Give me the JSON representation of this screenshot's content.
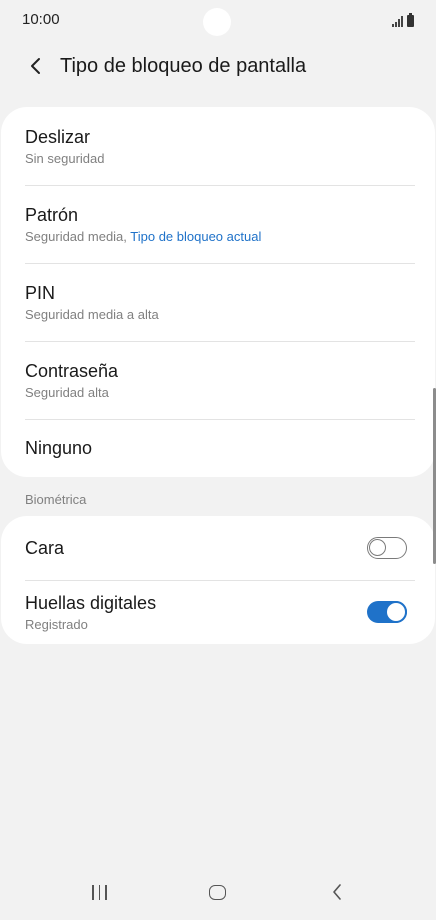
{
  "status_bar": {
    "time": "10:00",
    "icons": [
      "signal-icon",
      "battery-icon"
    ]
  },
  "header": {
    "back_icon": "chevron-left-icon",
    "title": "Tipo de bloqueo de pantalla"
  },
  "lock_types": [
    {
      "title": "Deslizar",
      "subtitle": "Sin seguridad"
    },
    {
      "title": "Patrón",
      "subtitle": "Seguridad media, ",
      "subtitle_accent": "Tipo de bloqueo actual"
    },
    {
      "title": "PIN",
      "subtitle": "Seguridad media a alta"
    },
    {
      "title": "Contraseña",
      "subtitle": "Seguridad alta"
    },
    {
      "title": "Ninguno"
    }
  ],
  "biometrics": {
    "section_label": "Biométrica",
    "items": [
      {
        "title": "Cara",
        "toggle_on": false
      },
      {
        "title": "Huellas digitales",
        "subtitle": "Registrado",
        "toggle_on": true
      }
    ]
  },
  "colors": {
    "accent": "#1f72c9",
    "background": "#f2f2f2",
    "card": "#ffffff"
  },
  "nav_bar": {
    "icons": [
      "recents-icon",
      "home-icon",
      "back-icon"
    ]
  }
}
